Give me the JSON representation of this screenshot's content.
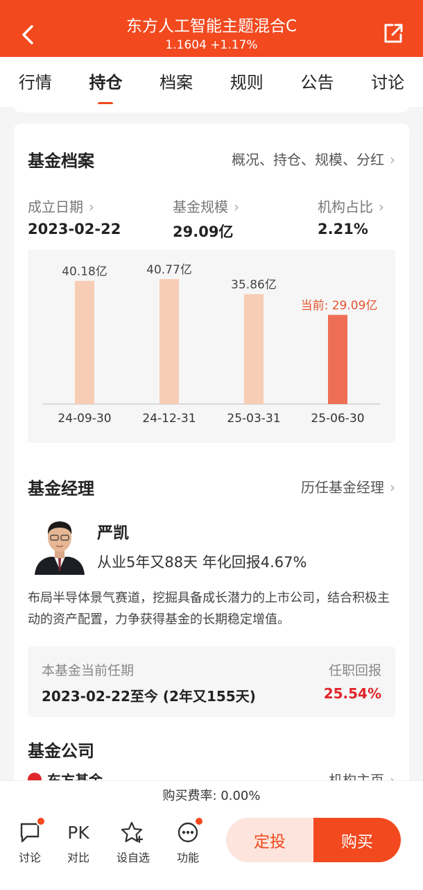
{
  "header": {
    "title": "东方人工智能主题混合C",
    "subtitle": "1.1604 +1.17%",
    "accent": "#f2491f"
  },
  "tabs": [
    {
      "label": "行情",
      "active": false
    },
    {
      "label": "持仓",
      "active": true
    },
    {
      "label": "档案",
      "active": false
    },
    {
      "label": "规则",
      "active": false
    },
    {
      "label": "公告",
      "active": false
    },
    {
      "label": "讨论",
      "active": false
    }
  ],
  "profile": {
    "title": "基金档案",
    "link": "概况、持仓、规模、分红",
    "stats": [
      {
        "label": "成立日期",
        "value": "2023-02-22"
      },
      {
        "label": "基金规模",
        "value": "29.09亿"
      },
      {
        "label": "机构占比",
        "value": "2.21%"
      }
    ]
  },
  "chart_data": {
    "type": "bar",
    "categories": [
      "24-09-30",
      "24-12-31",
      "25-03-31",
      "25-06-30"
    ],
    "values": [
      40.18,
      40.77,
      35.86,
      29.09
    ],
    "value_labels": [
      "40.18亿",
      "40.77亿",
      "35.86亿",
      "当前: 29.09亿"
    ],
    "highlight_index": 3,
    "bar_color": "#f8cdb5",
    "highlight_color": "#ee6f55",
    "highlight_label_color": "#e3522e",
    "unit": "亿"
  },
  "manager": {
    "title": "基金经理",
    "link": "历任基金经理",
    "name": "严凯",
    "stat": "从业5年又88天 年化回报4.67%",
    "description": "布局半导体景气赛道，挖掘具备成长潜力的上市公司，结合积极主动的资产配置，力争获得基金的长期稳定增值。",
    "tenure_label": "本基金当前任期",
    "tenure_value": "2023-02-22至今 (2年又155天)",
    "return_label": "任职回报",
    "return_value": "25.54%"
  },
  "company": {
    "title": "基金公司",
    "name": "东方基金",
    "link": "机构主页"
  },
  "fee": "购买费率: 0.00%",
  "bottom_nav": [
    {
      "label": "讨论",
      "icon": "chat-icon",
      "dot": true
    },
    {
      "label": "对比",
      "icon": "pk-icon",
      "glyph": "PK",
      "dot": false
    },
    {
      "label": "设自选",
      "icon": "star-add-icon",
      "dot": false
    },
    {
      "label": "功能",
      "icon": "more-icon",
      "dot": true
    }
  ],
  "actions": {
    "sip": "定投",
    "buy": "购买"
  }
}
